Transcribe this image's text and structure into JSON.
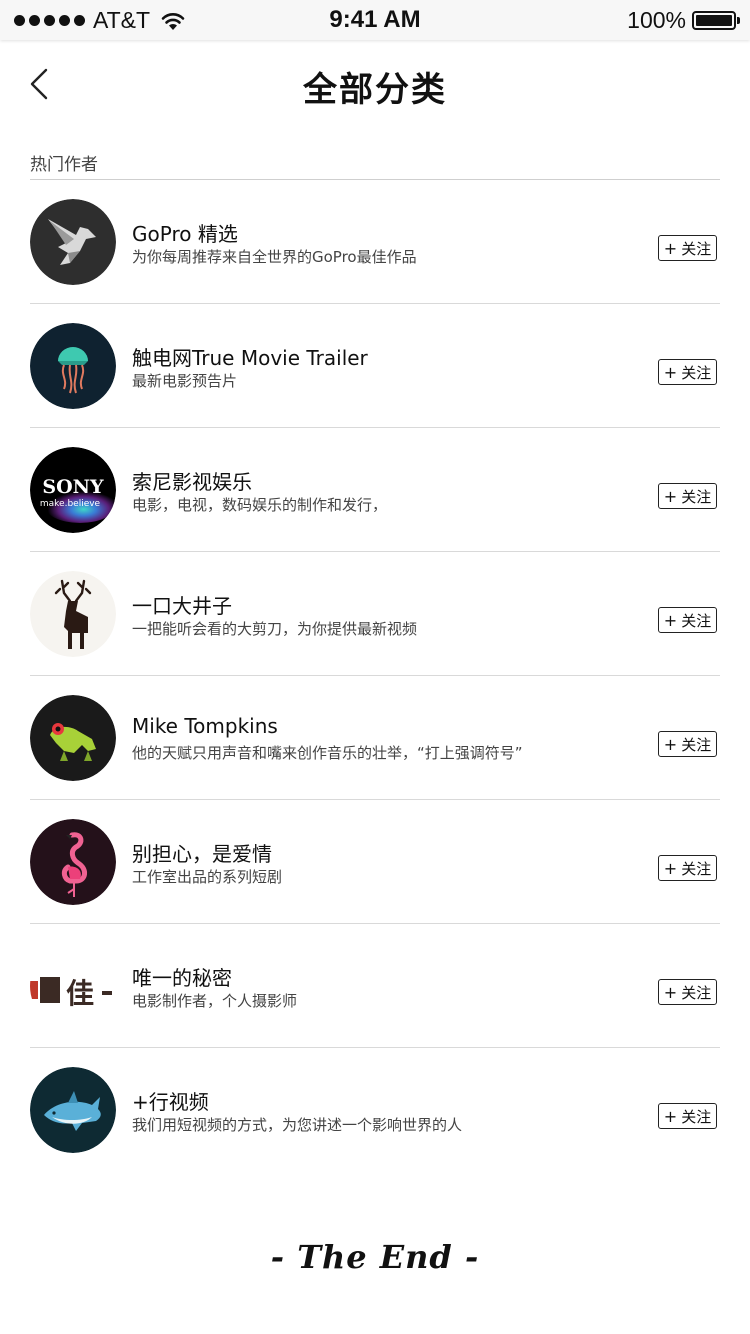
{
  "status_bar": {
    "carrier": "AT&T",
    "time": "9:41 AM",
    "battery": "100%",
    "battery_level": 1.0
  },
  "nav": {
    "title": "全部分类",
    "back_icon": "chevron-left-icon"
  },
  "section": {
    "label": "热门作者"
  },
  "authors": [
    {
      "name": "GoPro 精选",
      "desc": "为你每周推荐来自全世界的GoPro最佳作品",
      "follow_label": "关注",
      "avatar_icon": "bird-logo-icon"
    },
    {
      "name": "触电网True Movie Trailer",
      "desc": "最新电影预告片",
      "follow_label": "关注",
      "avatar_icon": "jellyfish-logo-icon"
    },
    {
      "name": "索尼影视娱乐",
      "desc": "电影，电视，数码娱乐的制作和发行，",
      "follow_label": "关注",
      "avatar_icon": "sony-logo-icon"
    },
    {
      "name": "一口大井子",
      "desc": "一把能听会看的大剪刀，为你提供最新视频",
      "follow_label": "关注",
      "avatar_icon": "deer-logo-icon"
    },
    {
      "name": "Mike Tompkins",
      "desc": "他的天赋只用声音和嘴来创作音乐的壮举，“打上强调符号”",
      "follow_label": "关注",
      "avatar_icon": "frog-logo-icon"
    },
    {
      "name": "别担心，是爱情",
      "desc": "工作室出品的系列短剧",
      "follow_label": "关注",
      "avatar_icon": "flamingo-logo-icon"
    },
    {
      "name": "唯一的秘密",
      "desc": "电影制作者，个人摄影师",
      "follow_label": "关注",
      "avatar_icon": "text-logo-icon"
    },
    {
      "name": "+行视频",
      "desc": "我们用短视频的方式，为您讲述一个影响世界的人",
      "follow_label": "关注",
      "avatar_icon": "shark-logo-icon"
    }
  ],
  "logos": {
    "sony_text": "SONY",
    "sony_tagline": "make.believe",
    "wei_text": "佳"
  },
  "footer": {
    "text": "- The End -"
  }
}
